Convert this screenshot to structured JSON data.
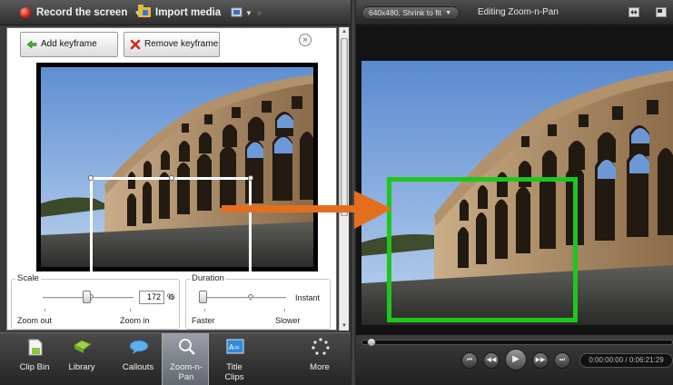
{
  "colors": {
    "record_red": "#d21f10",
    "zoom_rect_green": "#1fc51f",
    "arrow_orange": "#e36f1e"
  },
  "toolbar": {
    "record_label": "Record the screen",
    "import_label": "Import media"
  },
  "editor": {
    "add_keyframe_label": "Add keyframe",
    "remove_keyframe_label": "Remove keyframe",
    "scale": {
      "legend": "Scale",
      "value": "172",
      "unit": "%",
      "min_label": "Zoom out",
      "max_label": "Zoom in"
    },
    "duration": {
      "legend": "Duration",
      "value_label": "Instant",
      "min_label": "Faster",
      "max_label": "Slower"
    }
  },
  "tabs": [
    {
      "label": "Clip Bin",
      "icon": "clip-bin-icon"
    },
    {
      "label": "Library",
      "icon": "library-icon"
    },
    {
      "label": "Callouts",
      "icon": "callouts-icon"
    },
    {
      "label": "Zoom-n-\nPan",
      "icon": "magnifier-icon",
      "active": true
    },
    {
      "label": "Title\nClips",
      "icon": "title-clips-icon"
    },
    {
      "label": "More",
      "icon": "more-icon"
    }
  ],
  "preview": {
    "size_dropdown": "640x480, Shrink to fit",
    "title": "Editing Zoom-n-Pan",
    "timecode": "0:00:00:00 / 0:06:21:29"
  }
}
